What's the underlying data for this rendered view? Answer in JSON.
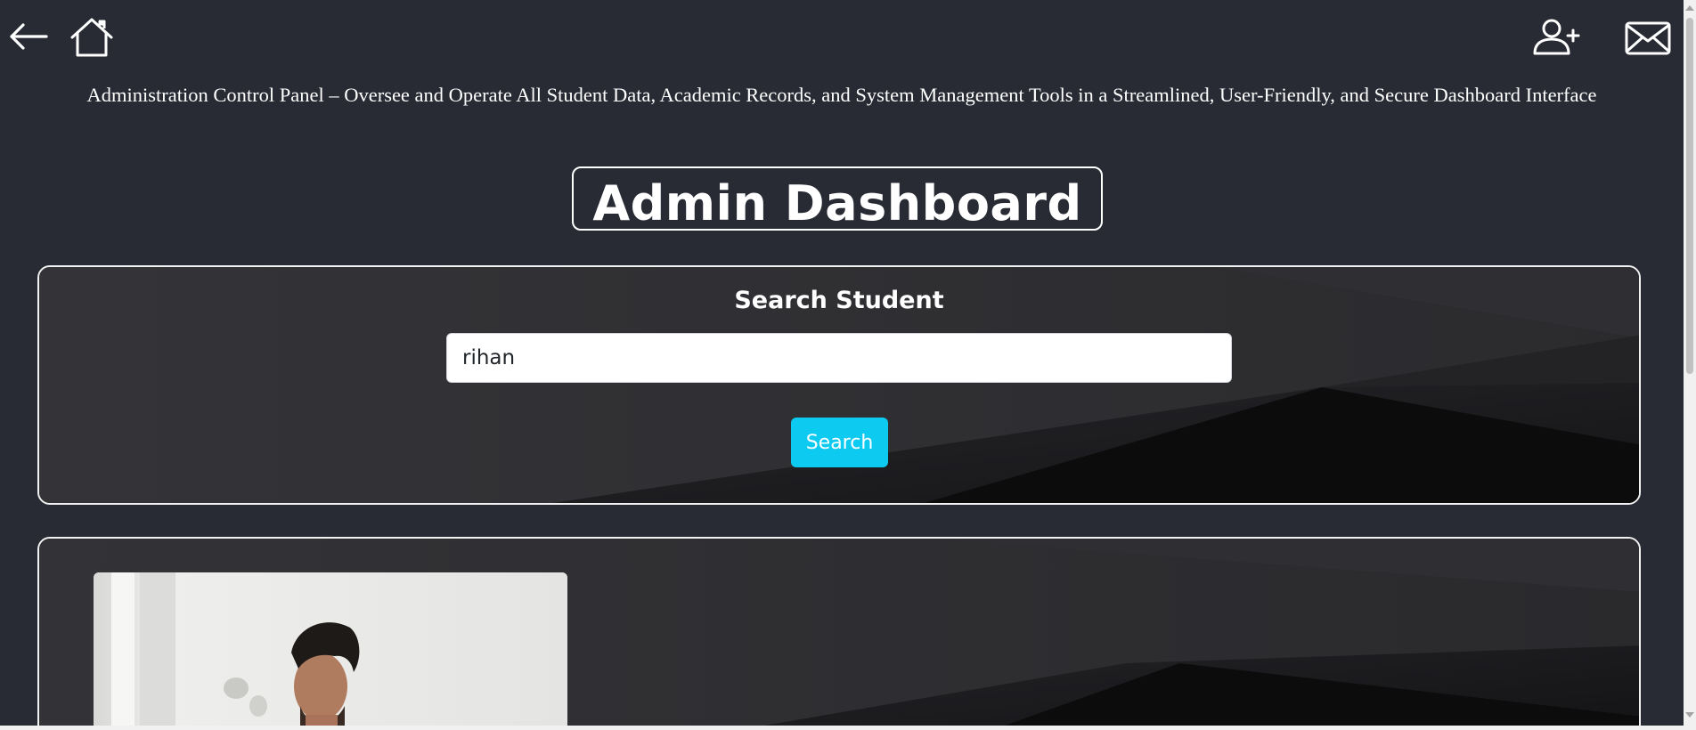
{
  "nav": {
    "back_icon": "arrow-left-icon",
    "home_icon": "home-icon",
    "add_user_icon": "person-plus-icon",
    "mail_icon": "envelope-icon"
  },
  "header": {
    "subtitle": "Administration Control Panel – Oversee and Operate All Student Data, Academic Records, and System Management Tools in a Streamlined, User-Friendly, and Secure Dashboard Interface",
    "title": "Admin Dashboard"
  },
  "search": {
    "heading": "Search Student",
    "input_value": "rihan",
    "button_label": "Search"
  },
  "colors": {
    "page_background": "#282b34",
    "accent": "#0dcaf0",
    "border": "#ffffff"
  }
}
